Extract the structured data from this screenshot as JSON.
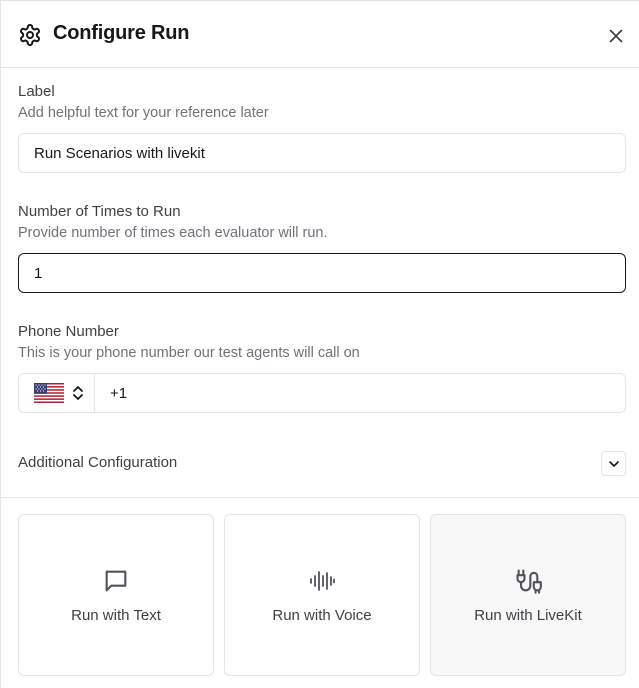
{
  "dialog": {
    "title": "Configure Run",
    "icon": "gear-icon",
    "close_icon": "close-icon"
  },
  "fields": {
    "label": {
      "label": "Label",
      "help": "Add helpful text for your reference later",
      "value": "Run Scenarios with livekit"
    },
    "times": {
      "label": "Number of Times to Run",
      "help": "Provide number of times each evaluator will run.",
      "value": "1"
    },
    "phone": {
      "label": "Phone Number",
      "help": "This is your phone number our test agents will call on",
      "country_icon": "us-flag-icon",
      "value": "+1"
    }
  },
  "additional": {
    "label": "Additional Configuration",
    "icon": "chevron-down-icon"
  },
  "run_options": [
    {
      "label": "Run with Text",
      "icon": "message-icon",
      "selected": false
    },
    {
      "label": "Run with Voice",
      "icon": "audio-waveform-icon",
      "selected": false
    },
    {
      "label": "Run with LiveKit",
      "icon": "plug-icon",
      "selected": true
    }
  ],
  "colors": {
    "border": "#e4e4e7",
    "text": "#18181b",
    "muted": "#71717a",
    "selected_bg": "#f8f8f9"
  }
}
